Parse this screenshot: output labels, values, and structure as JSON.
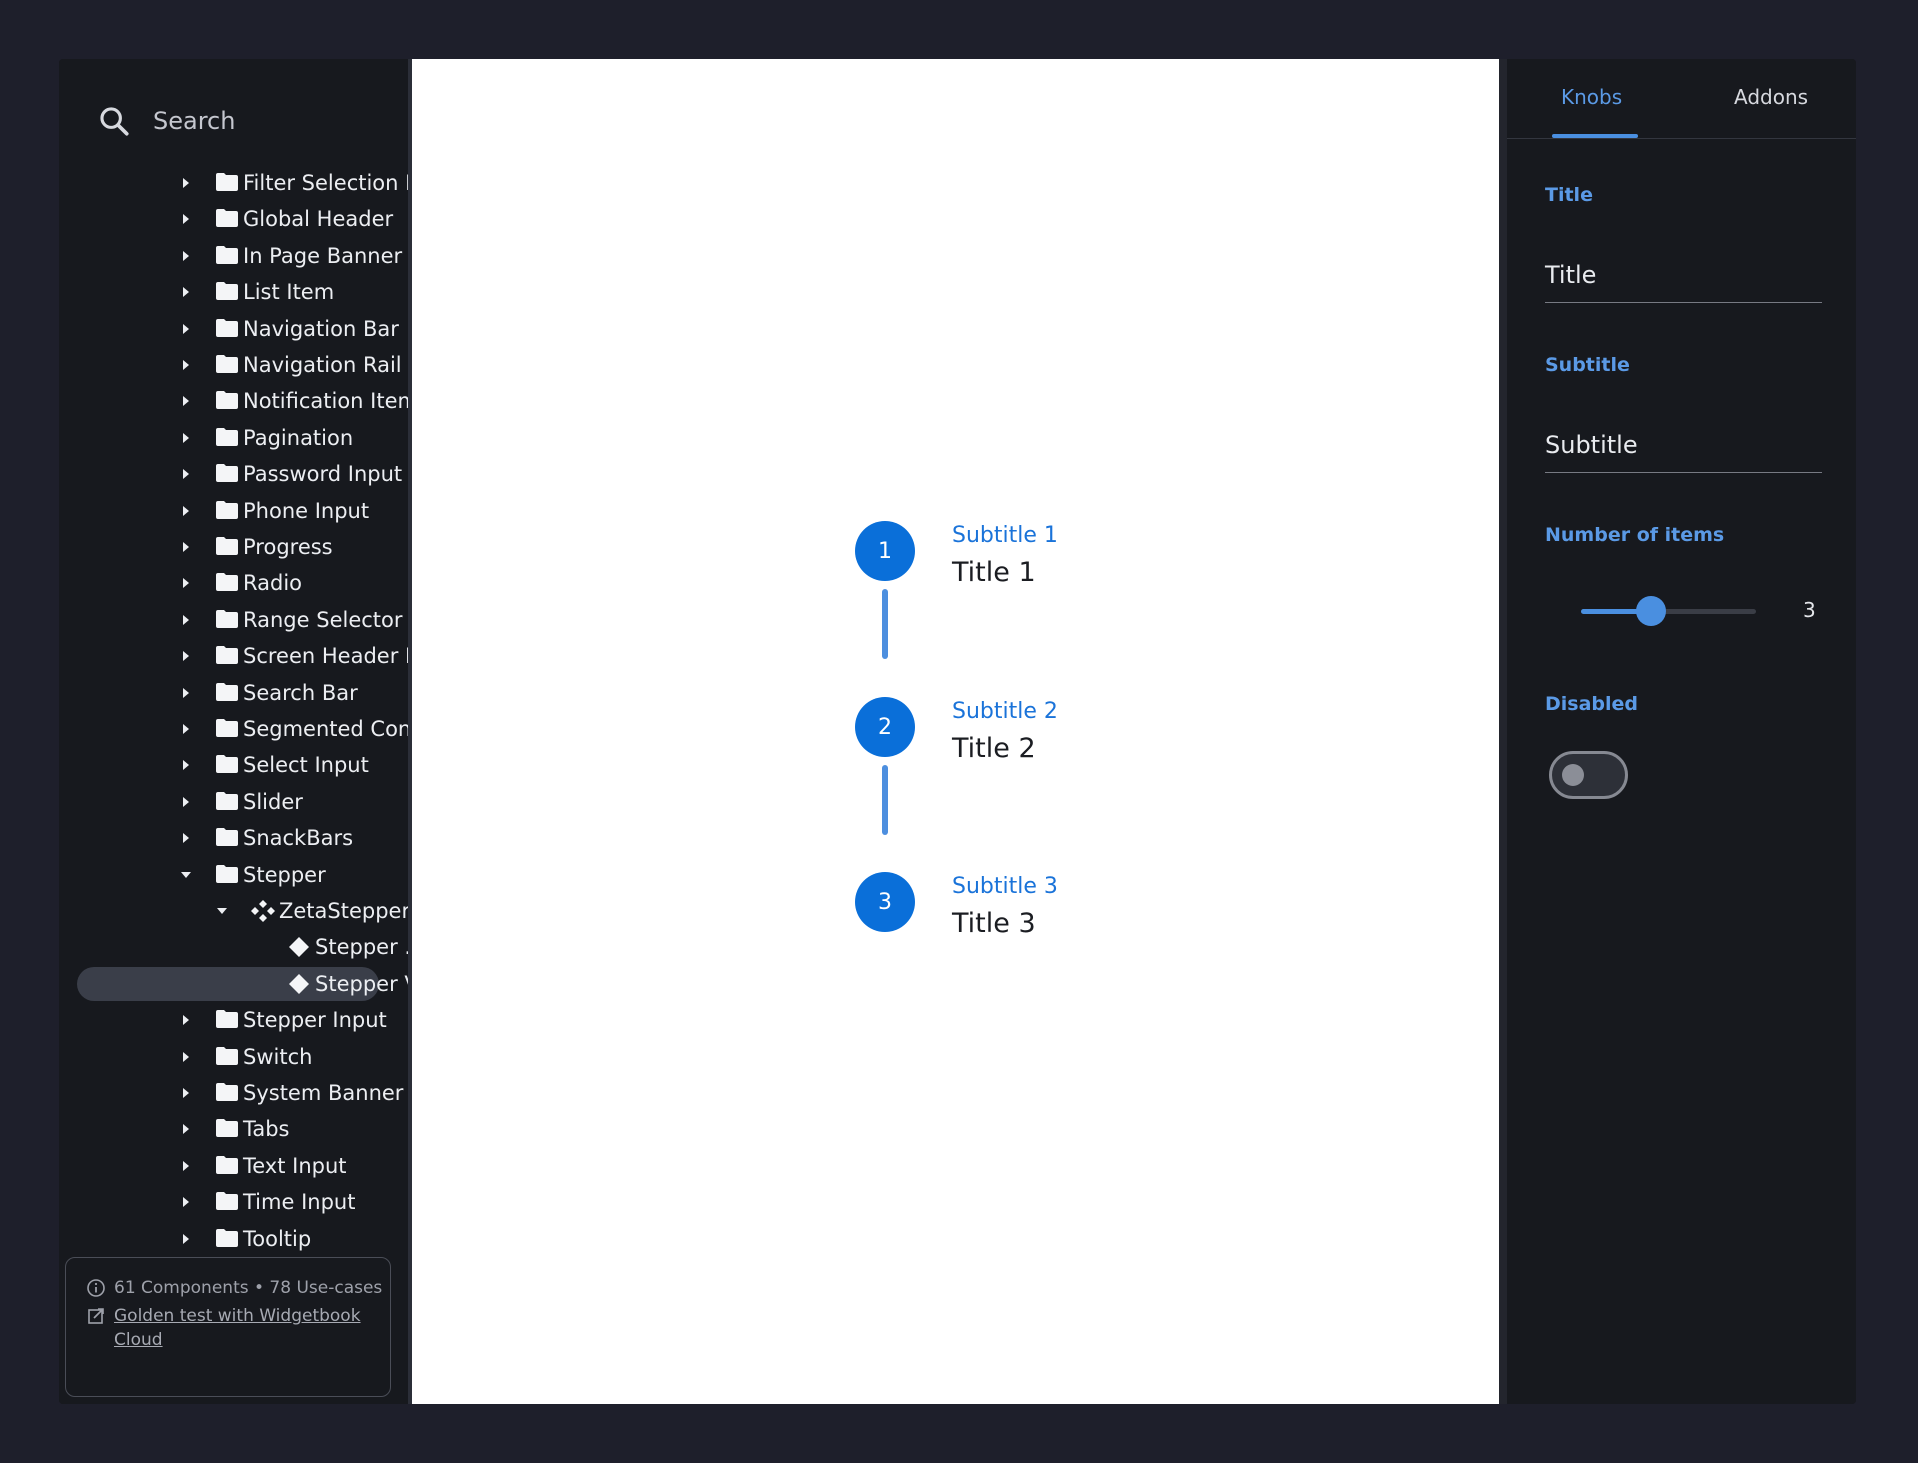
{
  "sidebar": {
    "search_placeholder": "Search",
    "tree": [
      {
        "label": "Filter Selection B...",
        "type": "folder",
        "expanded": false,
        "depth": 0
      },
      {
        "label": "Global Header",
        "type": "folder",
        "expanded": false,
        "depth": 0
      },
      {
        "label": "In Page Banner",
        "type": "folder",
        "expanded": false,
        "depth": 0
      },
      {
        "label": "List Item",
        "type": "folder",
        "expanded": false,
        "depth": 0
      },
      {
        "label": "Navigation Bar",
        "type": "folder",
        "expanded": false,
        "depth": 0
      },
      {
        "label": "Navigation Rail",
        "type": "folder",
        "expanded": false,
        "depth": 0
      },
      {
        "label": "Notification Item",
        "type": "folder",
        "expanded": false,
        "depth": 0
      },
      {
        "label": "Pagination",
        "type": "folder",
        "expanded": false,
        "depth": 0
      },
      {
        "label": "Password Input",
        "type": "folder",
        "expanded": false,
        "depth": 0
      },
      {
        "label": "Phone Input",
        "type": "folder",
        "expanded": false,
        "depth": 0
      },
      {
        "label": "Progress",
        "type": "folder",
        "expanded": false,
        "depth": 0
      },
      {
        "label": "Radio",
        "type": "folder",
        "expanded": false,
        "depth": 0
      },
      {
        "label": "Range Selector",
        "type": "folder",
        "expanded": false,
        "depth": 0
      },
      {
        "label": "Screen Header Bar",
        "type": "folder",
        "expanded": false,
        "depth": 0
      },
      {
        "label": "Search Bar",
        "type": "folder",
        "expanded": false,
        "depth": 0
      },
      {
        "label": "Segmented Cont...",
        "type": "folder",
        "expanded": false,
        "depth": 0
      },
      {
        "label": "Select Input",
        "type": "folder",
        "expanded": false,
        "depth": 0
      },
      {
        "label": "Slider",
        "type": "folder",
        "expanded": false,
        "depth": 0
      },
      {
        "label": "SnackBars",
        "type": "folder",
        "expanded": false,
        "depth": 0
      },
      {
        "label": "Stepper",
        "type": "folder",
        "expanded": true,
        "depth": 0
      },
      {
        "label": "ZetaStepper",
        "type": "component",
        "expanded": true,
        "depth": 1
      },
      {
        "label": "Stepper ...",
        "type": "usecase",
        "depth": 2,
        "selected": false
      },
      {
        "label": "Stepper V...",
        "type": "usecase",
        "depth": 2,
        "selected": true
      },
      {
        "label": "Stepper Input",
        "type": "folder",
        "expanded": false,
        "depth": 0
      },
      {
        "label": "Switch",
        "type": "folder",
        "expanded": false,
        "depth": 0
      },
      {
        "label": "System Banner",
        "type": "folder",
        "expanded": false,
        "depth": 0
      },
      {
        "label": "Tabs",
        "type": "folder",
        "expanded": false,
        "depth": 0
      },
      {
        "label": "Text Input",
        "type": "folder",
        "expanded": false,
        "depth": 0
      },
      {
        "label": "Time Input",
        "type": "folder",
        "expanded": false,
        "depth": 0
      },
      {
        "label": "Tooltip",
        "type": "folder",
        "expanded": false,
        "depth": 0
      }
    ],
    "info": {
      "stats_text": "61 Components • 78 Use-cases",
      "link_text": "Golden test with Widgetbook Cloud"
    }
  },
  "canvas": {
    "steps": [
      {
        "number": "1",
        "subtitle": "Subtitle 1",
        "title": "Title 1"
      },
      {
        "number": "2",
        "subtitle": "Subtitle 2",
        "title": "Title 2"
      },
      {
        "number": "3",
        "subtitle": "Subtitle 3",
        "title": "Title 3"
      }
    ]
  },
  "panel": {
    "tabs": [
      {
        "label": "Knobs",
        "active": true
      },
      {
        "label": "Addons",
        "active": false
      }
    ],
    "knobs": {
      "title_label": "Title",
      "title_value": "Title",
      "subtitle_label": "Subtitle",
      "subtitle_value": "Subtitle",
      "items_label": "Number of items",
      "items_value": "3",
      "items_fill_fraction": 0.4,
      "disabled_label": "Disabled",
      "disabled_on": false
    }
  },
  "colors": {
    "accent": "#0a6fd9",
    "accent_light": "#4a8fe0",
    "bg_dark": "#17191e",
    "frame": "#1e1f2b"
  }
}
